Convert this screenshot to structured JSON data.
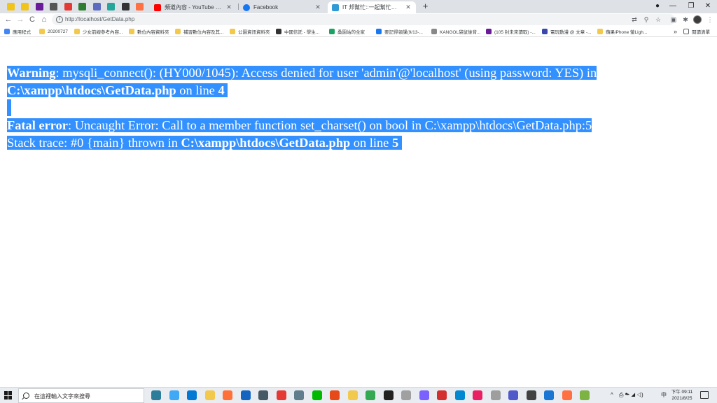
{
  "browser": {
    "tabs": [
      {
        "label": "頻道內容 - YouTube Studio",
        "icon": "youtube-icon",
        "color": "#ff0000"
      },
      {
        "label": "Facebook",
        "icon": "facebook-icon",
        "color": "#1877f2"
      },
      {
        "label": "IT 邦幫忙::一起幫忙解決難題，拯救 IT 人的一天",
        "icon": "ithelp-icon",
        "color": "#2e9bd6",
        "active": true
      }
    ],
    "pinned_tab_colors": [
      "#f0c419",
      "#f0c419",
      "#6a1b9a",
      "#555555",
      "#e53935",
      "#2e7d32",
      "#5c6bc0",
      "#26a69a",
      "#333333",
      "#ff7043"
    ],
    "new_tab_label": "+",
    "window_controls": {
      "profile": "●",
      "minimize": "—",
      "restore": "❐",
      "close": "✕"
    },
    "nav": {
      "back": "←",
      "forward": "→",
      "reload": "C",
      "home": "⌂"
    },
    "address": {
      "url": "http://localhost/GetData.php",
      "info_icon": "i"
    },
    "omnibox_actions": {
      "translate": "⇄",
      "zoom": "⚲",
      "bookmark_star": "☆"
    },
    "extensions": {
      "ext_a": "▣",
      "puzzle": "✱",
      "menu": "⋮"
    },
    "bookmarks": [
      {
        "label": "應用程式",
        "color": "#4285f4"
      },
      {
        "label": "20200727",
        "color": "#f2c94c"
      },
      {
        "label": "少女前線參考內容...",
        "color": "#f2c94c"
      },
      {
        "label": "數位內容資料夾",
        "color": "#f2c94c"
      },
      {
        "label": "補習數位內容及其...",
        "color": "#f2c94c"
      },
      {
        "label": "公園資訊資料夾",
        "color": "#f2c94c"
      },
      {
        "label": "中國信託 - 學生...",
        "color": "#333333"
      },
      {
        "label": "桑園站的全家",
        "color": "#1aa260"
      },
      {
        "label": "要記得領課(9/13-...",
        "color": "#1877f2"
      },
      {
        "label": "KANGOL袋鼠後背...",
        "color": "#888888"
      },
      {
        "label": "(105 封未來讀取) -...",
        "color": "#6a1b9a"
      },
      {
        "label": "電玩動漫 @ 文章 -...",
        "color": "#3949ab"
      },
      {
        "label": "蘋果iPhone 螢Ligh...",
        "color": "#f2c94c"
      }
    ],
    "bookmarks_overflow": "»",
    "reading_list": "閱讀清單"
  },
  "page": {
    "warning": {
      "label": "Warning",
      "message": ": mysqli_connect(): (HY000/1045): Access denied for user 'admin'@'localhost' (using password: YES) in",
      "file": "C:\\xampp\\htdocs\\GetData.php",
      "on_line": " on line ",
      "line": "4"
    },
    "fatal": {
      "label": "Fatal error",
      "message": ": Uncaught Error: Call to a member function set_charset() on bool in C:\\xampp\\htdocs\\GetData.php:5",
      "trace_prefix": "Stack trace: #0 {main} thrown in ",
      "file": "C:\\xampp\\htdocs\\GetData.php",
      "on_line": " on line ",
      "line": "5"
    },
    "selection_color": "#3390ff"
  },
  "taskbar": {
    "search_placeholder": "在這裡輸入文字來搜尋",
    "app_colors": [
      "#2d7d9a",
      "#3fa9f5",
      "#0078d4",
      "#f2c94c",
      "#ff7139",
      "#1565c0",
      "#455a64",
      "#e53935",
      "#607d8b",
      "#00b900",
      "#e64a19",
      "#f2c94c",
      "#34a853",
      "#212121",
      "#a0a0a0",
      "#7b61ff",
      "#d32f2f",
      "#0288d1",
      "#e91e63",
      "#9e9e9e",
      "#5059c9",
      "#424242",
      "#1976d2",
      "#ff7043",
      "#7cb342"
    ],
    "tray": {
      "chevron": "^",
      "icons": "⎙ ☁ ◢ ◁)",
      "ime": "中"
    },
    "clock": {
      "time": "下午 09:11",
      "date": "2021/8/25"
    }
  }
}
